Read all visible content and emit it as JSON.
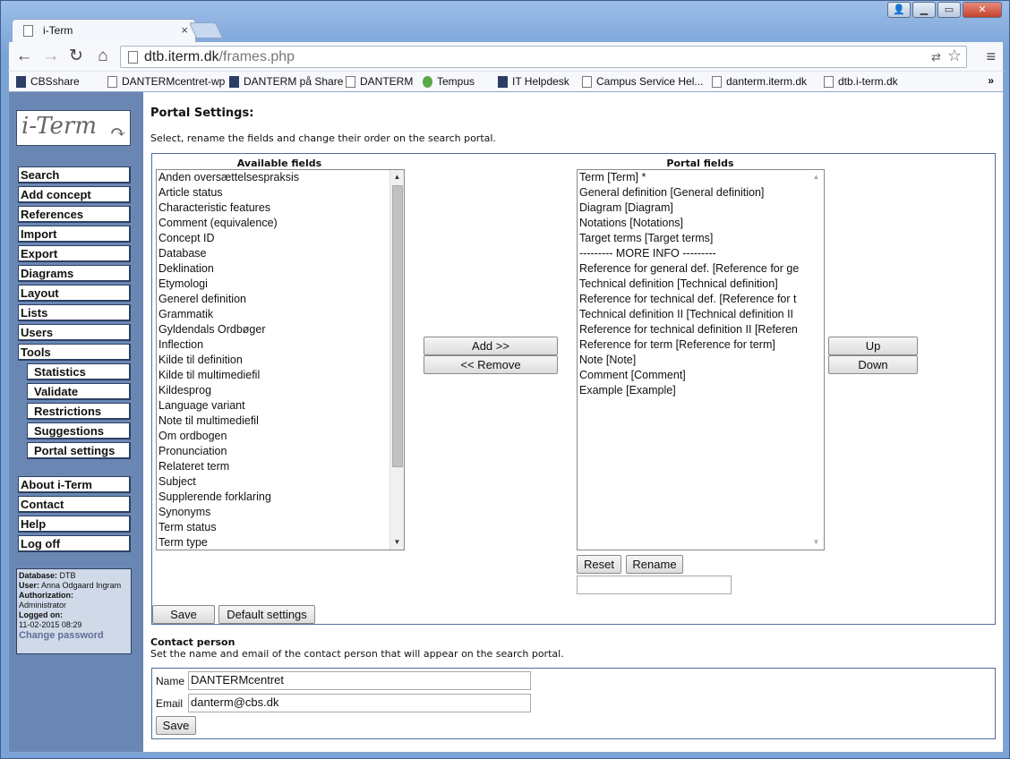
{
  "browser": {
    "tab_title": "i-Term",
    "tab_close": "×",
    "window_buttons": {
      "minimize": "▁",
      "maximize": "▭",
      "close": "✕",
      "user": "👤"
    },
    "url_host": "dtb.iterm.dk",
    "url_path": "/frames.php",
    "bookmarks": [
      {
        "label": "CBSshare",
        "icon": "dark"
      },
      {
        "label": "DANTERMcentret-wp",
        "icon": "page"
      },
      {
        "label": "DANTERM på Share",
        "icon": "dark"
      },
      {
        "label": "DANTERM",
        "icon": "page"
      },
      {
        "label": "Tempus",
        "icon": "green"
      },
      {
        "label": "IT Helpdesk",
        "icon": "dark"
      },
      {
        "label": "Campus Service Hel...",
        "icon": "page"
      },
      {
        "label": "danterm.iterm.dk",
        "icon": "page"
      },
      {
        "label": "dtb.i-term.dk",
        "icon": "page"
      }
    ],
    "bookmarks_more": "»"
  },
  "sidebar": {
    "logo_text": "i-Term",
    "main_menu": [
      "Search",
      "Add concept",
      "References",
      "Import",
      "Export",
      "Diagrams",
      "Layout",
      "Lists",
      "Users",
      "Tools"
    ],
    "tools_submenu": [
      "Statistics",
      "Validate",
      "Restrictions",
      "Suggestions",
      "Portal settings"
    ],
    "footer_menu": [
      "About i-Term",
      "Contact",
      "Help",
      "Log off"
    ],
    "info": {
      "database_label": "Database:",
      "database": "DTB",
      "user_label": "User:",
      "user": "Anna Odgaard Ingram",
      "authorization_label": "Authorization:",
      "authorization": "Administrator",
      "logged_on_label": "Logged on:",
      "logged_on": "11-02-2015 08:29",
      "change_password": "Change password"
    }
  },
  "portal_settings": {
    "title": "Portal Settings:",
    "description": "Select, rename the fields and change their order on the search portal.",
    "available_header": "Available fields",
    "portal_header": "Portal fields",
    "available_fields": [
      "Anden oversættelsespraksis",
      "Article status",
      "Characteristic features",
      "Comment (equivalence)",
      "Concept ID",
      "Database",
      "Deklination",
      "Etymologi",
      "Generel definition",
      "Grammatik",
      "Gyldendals Ordbøger",
      "Inflection",
      "Kilde til definition",
      "Kilde til multimediefil",
      "Kildesprog",
      "Language variant",
      "Note til multimediefil",
      "Om ordbogen",
      "Pronunciation",
      "Relateret term",
      "Subject",
      "Supplerende forklaring",
      "Synonyms",
      "Term status",
      "Term type"
    ],
    "portal_fields": [
      "Term [Term] *",
      "General definition [General definition]",
      "Diagram [Diagram]",
      "Notations [Notations]",
      "Target terms [Target terms]",
      "--------- MORE INFO ---------",
      "Reference for general def. [Reference for ge",
      "Technical definition [Technical definition]",
      "Reference for technical def. [Reference for t",
      "Technical definition II [Technical definition II",
      "Reference for technical definition II [Referen",
      "Reference for term [Reference for term]",
      "Note [Note]",
      "Comment [Comment]",
      "Example [Example]"
    ],
    "add_button": "Add >>",
    "remove_button": "<< Remove",
    "up_button": "Up",
    "down_button": "Down",
    "reset_button": "Reset",
    "rename_button": "Rename",
    "rename_value": "",
    "save_button": "Save",
    "default_button": "Default settings"
  },
  "contact": {
    "title": "Contact person",
    "description": "Set the name and email of the contact person that will appear on the search portal.",
    "name_label": "Name",
    "name_value": "DANTERMcentret",
    "email_label": "Email",
    "email_value": "danterm@cbs.dk",
    "save_button": "Save"
  }
}
